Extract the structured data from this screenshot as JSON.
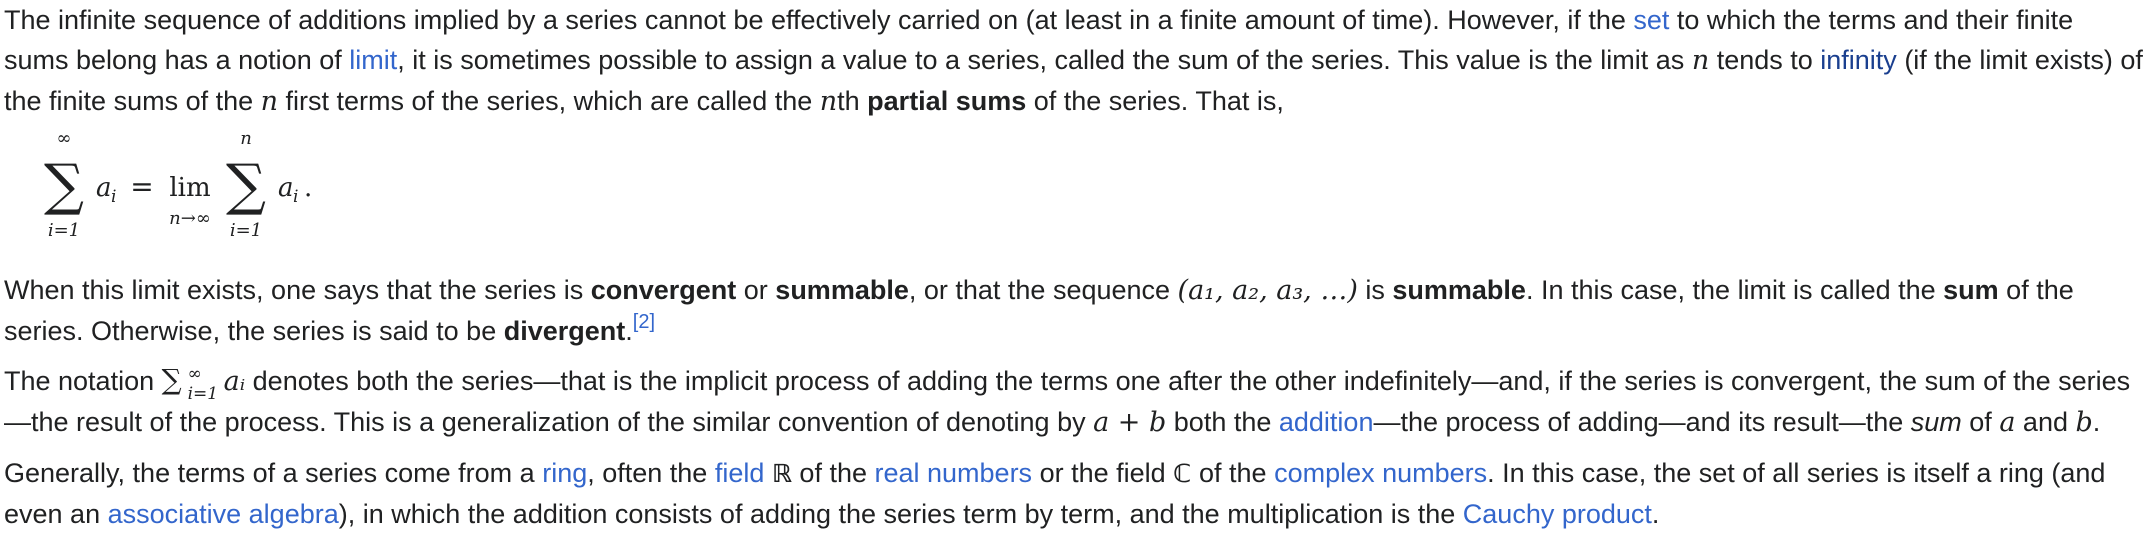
{
  "p1": {
    "t1": "The infinite sequence of additions implied by a series cannot be effectively carried on (at least in a finite amount of time). However, if the ",
    "link_set": "set",
    "t2": " to which the terms and their finite sums belong has a notion of ",
    "link_limit": "limit",
    "t3": ", it is sometimes possible to assign a value to a series, called the sum of the series. This value is the limit as ",
    "var_n1": "n",
    "t4": " tends to ",
    "link_infinity": "infinity",
    "t5": " (if the limit exists) of the finite sums of the ",
    "var_n2": "n",
    "t6": " first terms of the series, which are called the ",
    "var_n3": "n",
    "t7": "th ",
    "bold_partial_sums": "partial sums",
    "t8": " of the series. That is,"
  },
  "formula": {
    "sum_upper_1": "∞",
    "sum_lower_1": "i=1",
    "term_1": "a",
    "sub_1": "i",
    "equals": "=",
    "lim": "lim",
    "lim_sub": "n→∞",
    "sum_upper_2": "n",
    "sum_lower_2": "i=1",
    "term_2": "a",
    "sub_2": "i",
    "period": "."
  },
  "p2": {
    "t1": "When this limit exists, one says that the series is ",
    "bold_convergent": "convergent",
    "t2": " or ",
    "bold_summable1": "summable",
    "t3": ", or that the sequence ",
    "math_seq": "(a₁, a₂, a₃, …)",
    "t4": " is ",
    "bold_summable2": "summable",
    "t5": ". In this case, the limit is called the ",
    "bold_sum": "sum",
    "t6": " of the series. Otherwise, the series is said to be ",
    "bold_divergent": "divergent",
    "t7": ".",
    "ref": "[2]"
  },
  "p3": {
    "t1": "The notation ",
    "sig": "∑",
    "sig_upper": "∞",
    "sig_lower": "i=1",
    "sig_term": "aᵢ",
    "t2": " denotes both the series—that is the implicit process of adding the terms one after the other indefinitely—and, if the series is convergent, the sum of the series—the result of the process. This is a generalization of the similar convention of denoting by ",
    "math_aplusb": "a + b",
    "t3": " both the ",
    "link_addition": "addition",
    "t4": "—the process of adding—and its result—the ",
    "italic_sum": "sum",
    "t5": " of ",
    "var_a": "a",
    "t6": " and ",
    "var_b": "b",
    "t7": "."
  },
  "p4": {
    "t1": "Generally, the terms of a series come from a ",
    "link_ring": "ring",
    "t2": ", often the ",
    "link_field": "field",
    "math_R": "ℝ",
    "t3": " of the ",
    "link_real_numbers": "real numbers",
    "t4": " or the field ",
    "math_C": "ℂ",
    "t5": " of the ",
    "link_complex_numbers": "complex numbers",
    "t6": ". In this case, the set of all series is itself a ring (and even an ",
    "link_associative_algebra": "associative algebra",
    "t7": "), in which the addition consists of adding the series term by term, and the multiplication is the ",
    "link_cauchy_product": "Cauchy product",
    "t8": "."
  },
  "colors": {
    "text": "#202122",
    "link": "#3366cc",
    "link_visited": "#1a3f8f"
  }
}
